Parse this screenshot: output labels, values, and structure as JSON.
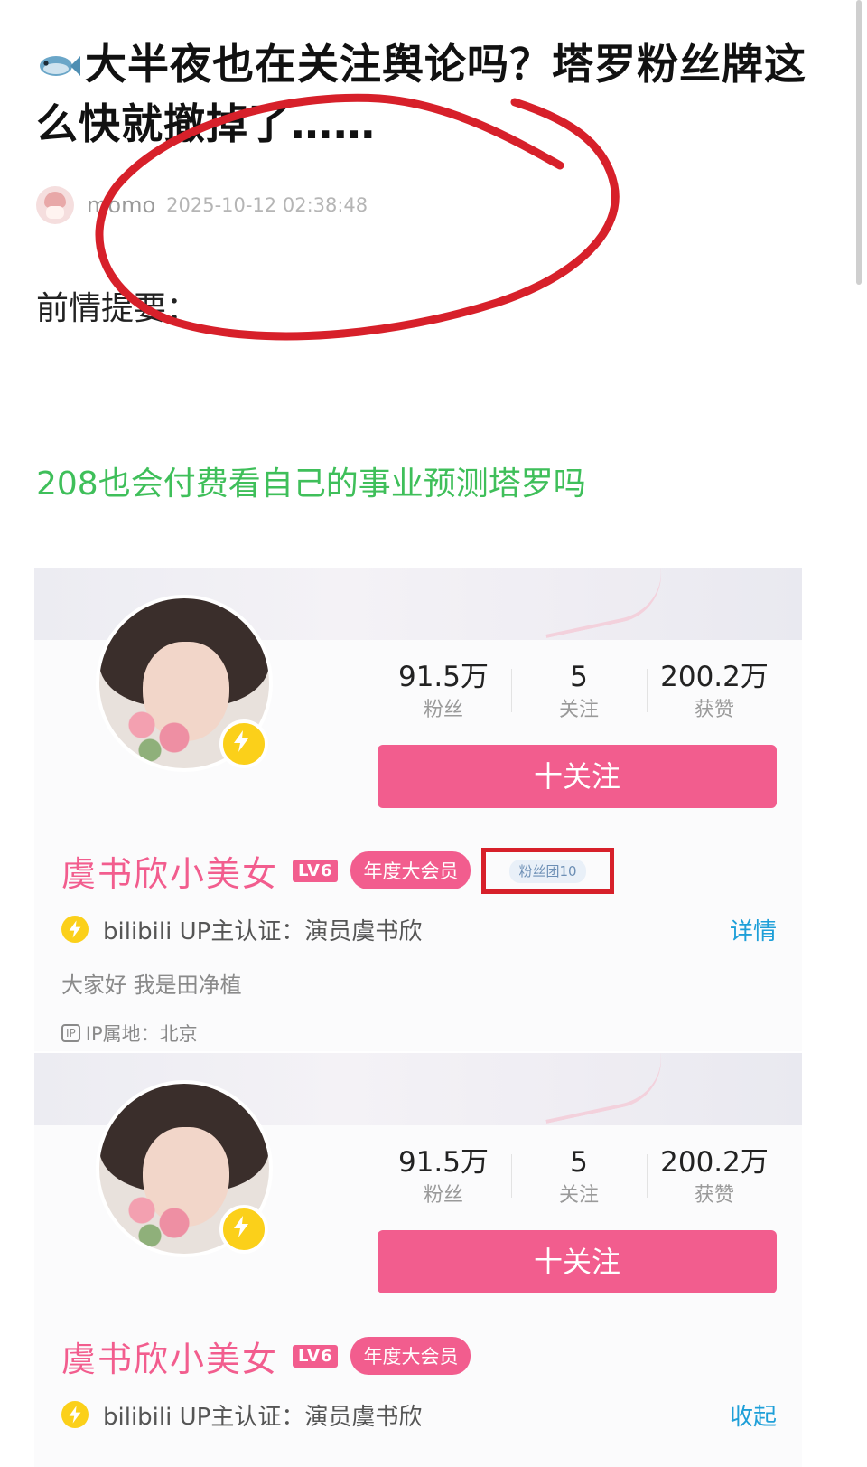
{
  "post": {
    "title": "大半夜也在关注舆论吗？塔罗粉丝牌这么快就撤掉了……",
    "author": "momo",
    "date": "2025-10-12 02:38:48",
    "intro": "前情提要：",
    "link_text": "208也会付费看自己的事业预测塔罗吗"
  },
  "colors": {
    "accent_pink": "#f25d8e",
    "link_green": "#3fbf5a",
    "detail_blue": "#1e9fd8",
    "annotation_red": "#d7202a"
  },
  "profiles": [
    {
      "stats": [
        {
          "value": "91.5万",
          "label": "粉丝"
        },
        {
          "value": "5",
          "label": "关注"
        },
        {
          "value": "200.2万",
          "label": "获赞"
        }
      ],
      "follow_label": "十关注",
      "name": "虞书欣小美女",
      "level": "LV6",
      "vip": "年度大会员",
      "fan_badge": "粉丝团10",
      "cert": "bilibili UP主认证：演员虞书欣",
      "cert_link": "详情",
      "bio": "大家好 我是田净植",
      "ip_icon": "IP",
      "ip": "IP属地：北京"
    },
    {
      "stats": [
        {
          "value": "91.5万",
          "label": "粉丝"
        },
        {
          "value": "5",
          "label": "关注"
        },
        {
          "value": "200.2万",
          "label": "获赞"
        }
      ],
      "follow_label": "十关注",
      "name": "虞书欣小美女",
      "level": "LV6",
      "vip": "年度大会员",
      "cert": "bilibili UP主认证：演员虞书欣",
      "cert_link": "收起"
    }
  ],
  "icons": [
    "fish-icon",
    "author-avatar",
    "lightning-icon",
    "ip-icon"
  ]
}
